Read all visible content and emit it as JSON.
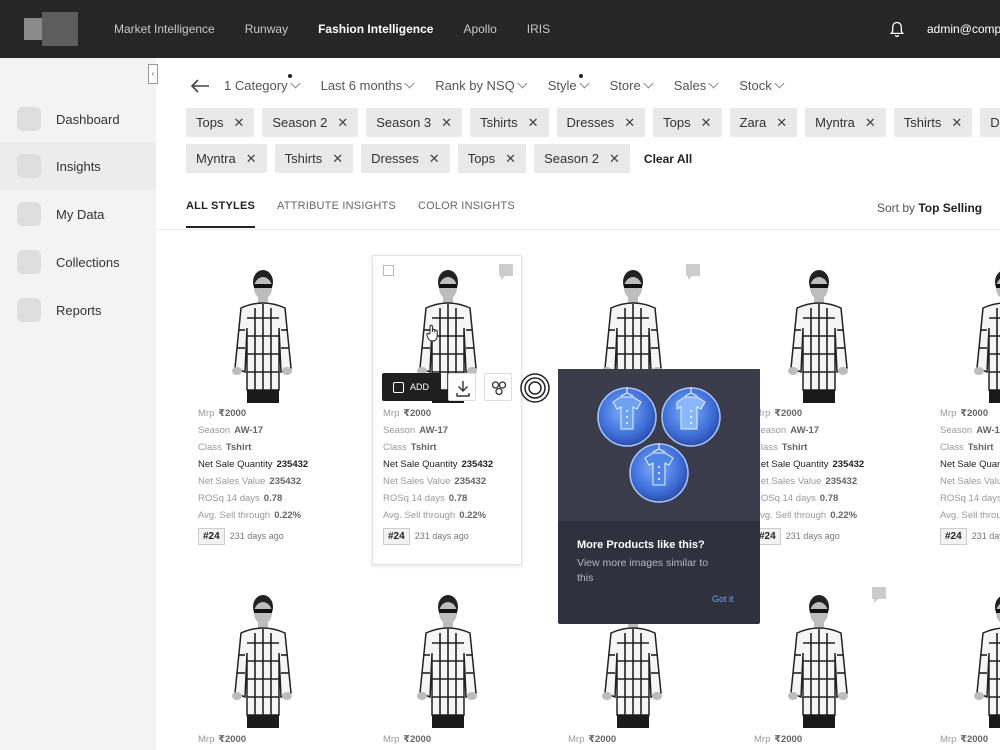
{
  "nav": {
    "items": [
      "Market Intelligence",
      "Runway",
      "Fashion Intelligence",
      "Apollo",
      "IRIS"
    ],
    "active": "Fashion Intelligence",
    "user": "admin@compa"
  },
  "sidebar": {
    "items": [
      {
        "label": "Dashboard"
      },
      {
        "label": "Insights"
      },
      {
        "label": "My Data"
      },
      {
        "label": "Collections"
      },
      {
        "label": "Reports"
      }
    ]
  },
  "filters": {
    "items": [
      "1 Category",
      "Last 6 months",
      "Rank by NSQ",
      "Style",
      "Store",
      "Sales",
      "Stock"
    ]
  },
  "chips": {
    "row1": [
      "Tops",
      "Season 2",
      "Season 3",
      "Tshirts",
      "Dresses",
      "Tops",
      "Zara",
      "Myntra",
      "Tshirts",
      "Dresses"
    ],
    "row2": [
      "Myntra",
      "Tshirts",
      "Dresses",
      "Tops",
      "Season 2"
    ],
    "clear_all": "Clear All"
  },
  "tabs": [
    "ALL STYLES",
    "ATTRIBUTE INSIGHTS",
    "COLOR INSIGHTS"
  ],
  "sort": {
    "label": "Sort by",
    "value": "Top Selling"
  },
  "product": {
    "mrp_label": "Mrp",
    "mrp": "₹2000",
    "season_label": "Season",
    "season": "AW-17",
    "class_label": "Class",
    "class": "Tshirt",
    "nsq_label": "Net Sale Quantity",
    "nsq": "235432",
    "nsv_label": "Net Sales Value",
    "nsv": "235432",
    "rosq_label": "ROSq 14 days",
    "rosq": "0.78",
    "sellthrough_label": "Avg. Sell through",
    "sellthrough": "0.22%",
    "rank": "#24",
    "age": "231 days ago"
  },
  "card_actions": {
    "add": "ADD"
  },
  "tooltip": {
    "title": "More Products like this?",
    "description": "View more images similar to this",
    "action": "Got it"
  }
}
